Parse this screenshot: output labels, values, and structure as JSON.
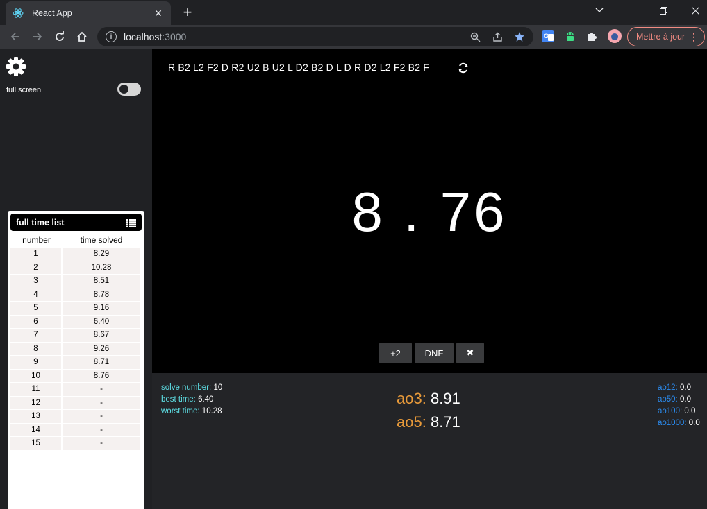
{
  "browser": {
    "tab_title": "React App",
    "url_host": "localhost",
    "url_port": ":3000",
    "update_button": "Mettre à jour"
  },
  "sidebar": {
    "full_screen_label": "full screen",
    "full_screen_on": false
  },
  "time_list": {
    "title": "full time list",
    "columns": [
      "number",
      "time solved"
    ],
    "rows": [
      [
        "1",
        "8.29"
      ],
      [
        "2",
        "10.28"
      ],
      [
        "3",
        "8.51"
      ],
      [
        "4",
        "8.78"
      ],
      [
        "5",
        "9.16"
      ],
      [
        "6",
        "6.40"
      ],
      [
        "7",
        "8.67"
      ],
      [
        "8",
        "9.26"
      ],
      [
        "9",
        "8.71"
      ],
      [
        "10",
        "8.76"
      ],
      [
        "11",
        "-"
      ],
      [
        "12",
        "-"
      ],
      [
        "13",
        "-"
      ],
      [
        "14",
        "-"
      ],
      [
        "15",
        "-"
      ]
    ]
  },
  "main": {
    "scramble": "R B2 L2 F2 D R2 U2 B U2 L D2 B2 D L D R D2 L2 F2 B2 F",
    "timer": "8 . 76",
    "buttons": {
      "plus2": "+2",
      "dnf": "DNF",
      "delete": "✖"
    }
  },
  "stats": {
    "solve_number_label": "solve number:",
    "solve_number": "10",
    "best_time_label": "best time:",
    "best_time": "6.40",
    "worst_time_label": "worst time:",
    "worst_time": "10.28",
    "ao3_label": "ao3:",
    "ao3": "8.91",
    "ao5_label": "ao5:",
    "ao5": "8.71",
    "ao12_label": "ao12:",
    "ao12": "0.0",
    "ao50_label": "ao50:",
    "ao50": "0.0",
    "ao100_label": "ao100:",
    "ao100": "0.0",
    "ao1000_label": "ao1000:",
    "ao1000": "0.0"
  },
  "colors": {
    "stat_label_cyan": "#5ee0e6",
    "ao_label_orange": "#e89a3a",
    "ao_small_blue": "#2b8cf0"
  }
}
